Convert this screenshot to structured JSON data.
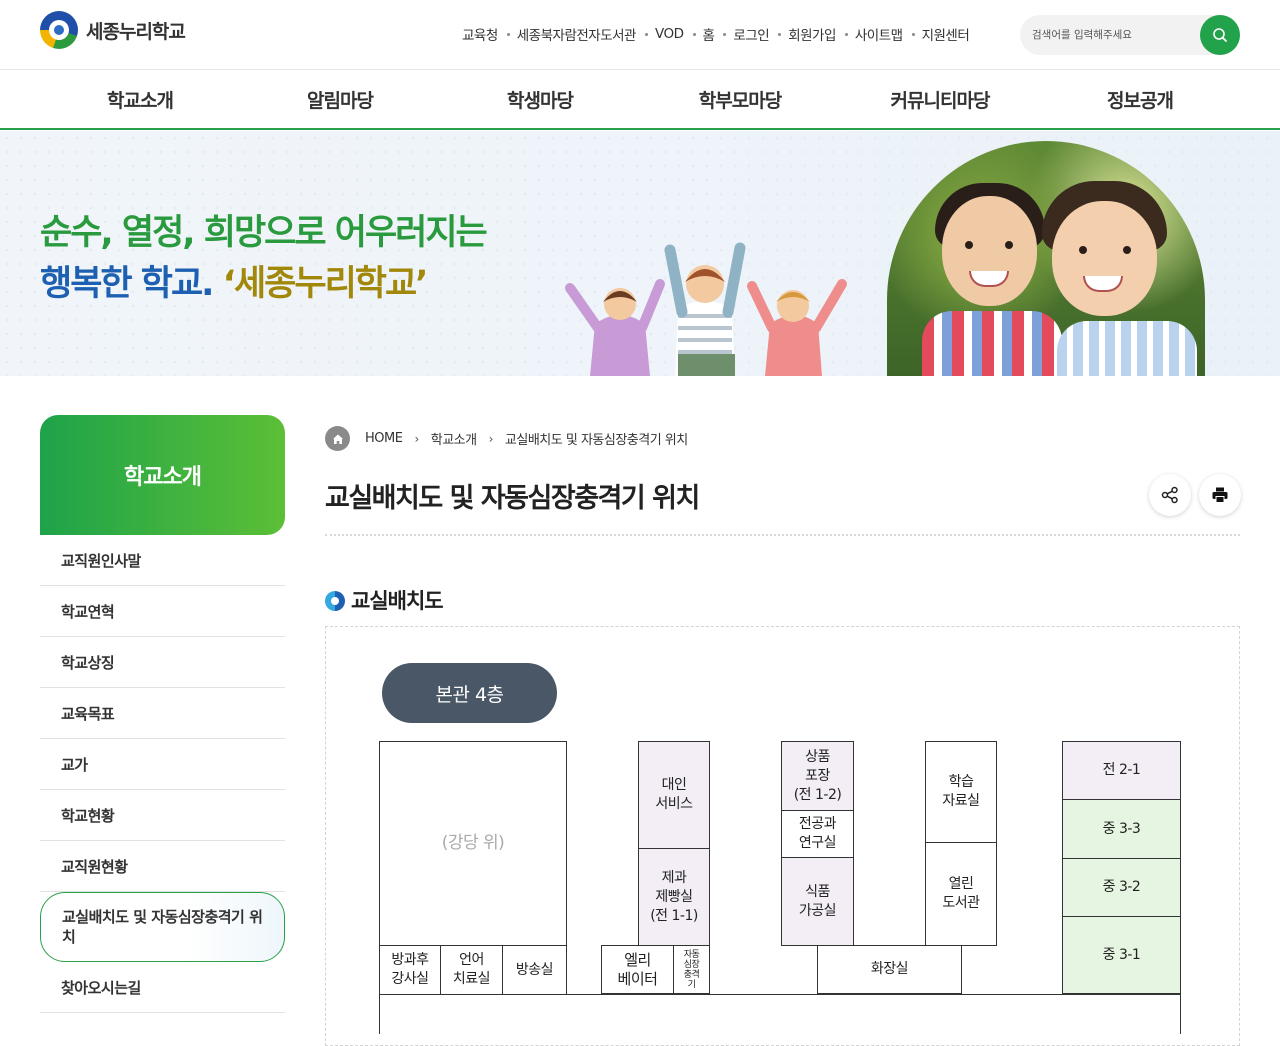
{
  "header": {
    "logo_text": "세종누리학교",
    "utility_links": [
      "교육청",
      "세종북자람전자도서관",
      "VOD",
      "홈",
      "로그인",
      "회원가입",
      "사이트맵",
      "지원센터"
    ],
    "search_placeholder": "검색어를 입력해주세요",
    "colors": {
      "accent": "#22a24a",
      "nav_border": "#2aa04a"
    }
  },
  "gnb": [
    "학교소개",
    "알림마당",
    "학생마당",
    "학부모마당",
    "커뮤니티마당",
    "정보공개"
  ],
  "banner": {
    "line1": "순수, 열정, 희망으로 어우러지는",
    "line2_prefix": "행복한 학교. ",
    "line2_brand": "‘세종누리학교’"
  },
  "sidebar": {
    "title": "학교소개",
    "items": [
      {
        "label": "교직원인사말"
      },
      {
        "label": "학교연혁"
      },
      {
        "label": "학교상징"
      },
      {
        "label": "교육목표"
      },
      {
        "label": "교가"
      },
      {
        "label": "학교현황"
      },
      {
        "label": "교직원현황"
      },
      {
        "label": "교실배치도 및 자동심장충격기 위치",
        "active": true
      },
      {
        "label": "찾아오시는길"
      }
    ]
  },
  "breadcrumb": [
    "HOME",
    "학교소개",
    "교실배치도 및 자동심장충격기 위치"
  ],
  "page_title": "교실배치도 및 자동심장충격기 위치",
  "section_title": "교실배치도",
  "floor_label": "본관 4층",
  "rooms": {
    "auditorium": "(강당 위)",
    "after_school_1": "방과후",
    "after_school_2": "강사실",
    "speech_1": "언어",
    "speech_2": "치료실",
    "broadcast": "방송실",
    "elevator_1": "엘리",
    "elevator_2": "베이터",
    "aed_1": "자동",
    "aed_2": "심장",
    "aed_3": "충격",
    "aed_4": "기",
    "service_1": "대인",
    "service_2": "서비스",
    "bakery_1": "제과",
    "bakery_2": "제빵실",
    "bakery_3": "(전 1-1)",
    "packing_1": "상품",
    "packing_2": "포장",
    "packing_3": "(전 1-2)",
    "research_1": "전공과",
    "research_2": "연구실",
    "food_1": "식품",
    "food_2": "가공실",
    "learning_1": "학습",
    "learning_2": "자료실",
    "library_1": "열린",
    "library_2": "도서관",
    "restroom": "화장실",
    "class_j21": "전 2-1",
    "class_m33": "중 3-3",
    "class_m32": "중 3-2",
    "class_m31": "중 3-1"
  }
}
